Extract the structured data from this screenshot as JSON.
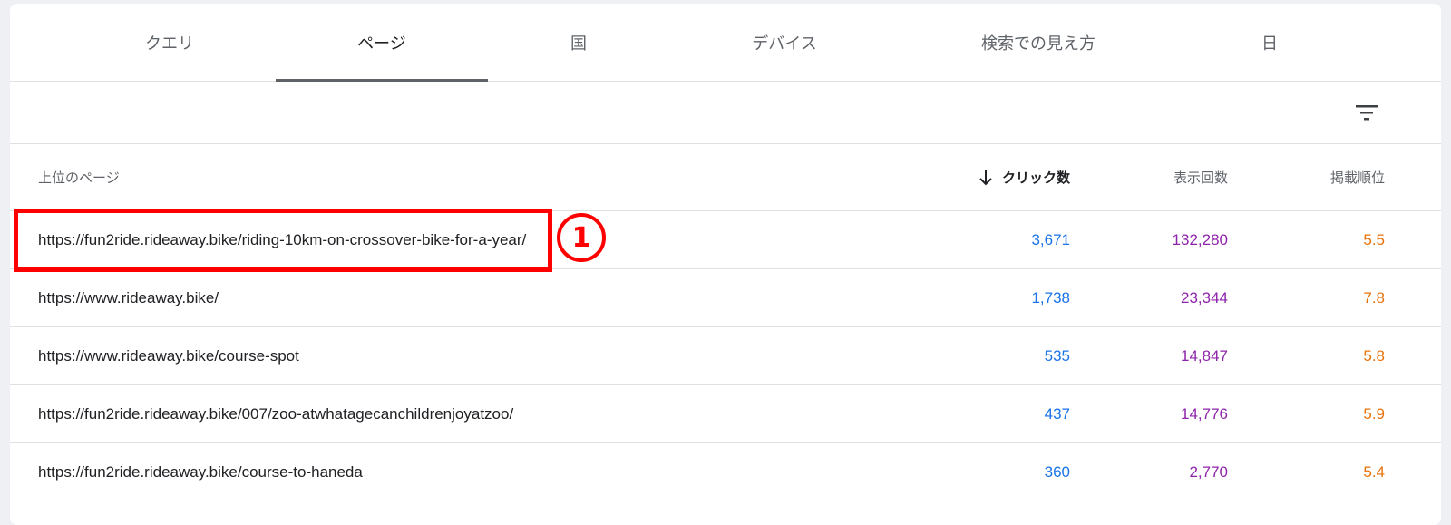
{
  "tabs": [
    {
      "label": "クエリ",
      "active": false
    },
    {
      "label": "ページ",
      "active": true
    },
    {
      "label": "国",
      "active": false
    },
    {
      "label": "デバイス",
      "active": false
    },
    {
      "label": "検索での見え方",
      "active": false
    },
    {
      "label": "日",
      "active": false
    }
  ],
  "toolbar": {
    "filter_icon": "filter-icon"
  },
  "table": {
    "headers": {
      "page": "上位のページ",
      "clicks": "クリック数",
      "impressions": "表示回数",
      "position": "掲載順位"
    },
    "sorted_column": "clicks",
    "sort_direction": "descending",
    "rows": [
      {
        "url": "https://fun2ride.rideaway.bike/riding-10km-on-crossover-bike-for-a-year/",
        "clicks": "3,671",
        "impressions": "132,280",
        "position": "5.5"
      },
      {
        "url": "https://www.rideaway.bike/",
        "clicks": "1,738",
        "impressions": "23,344",
        "position": "7.8"
      },
      {
        "url": "https://www.rideaway.bike/course-spot",
        "clicks": "535",
        "impressions": "14,847",
        "position": "5.8"
      },
      {
        "url": "https://fun2ride.rideaway.bike/007/zoo-atwhatagecanchildrenjoyatzoo/",
        "clicks": "437",
        "impressions": "14,776",
        "position": "5.9"
      },
      {
        "url": "https://fun2ride.rideaway.bike/course-to-haneda",
        "clicks": "360",
        "impressions": "2,770",
        "position": "5.4"
      }
    ]
  },
  "annotation": {
    "badge": "1"
  },
  "colors": {
    "clicks": "#1a73e8",
    "impressions": "#8e24aa",
    "position": "#e8710a",
    "annotation": "#ff0000"
  }
}
